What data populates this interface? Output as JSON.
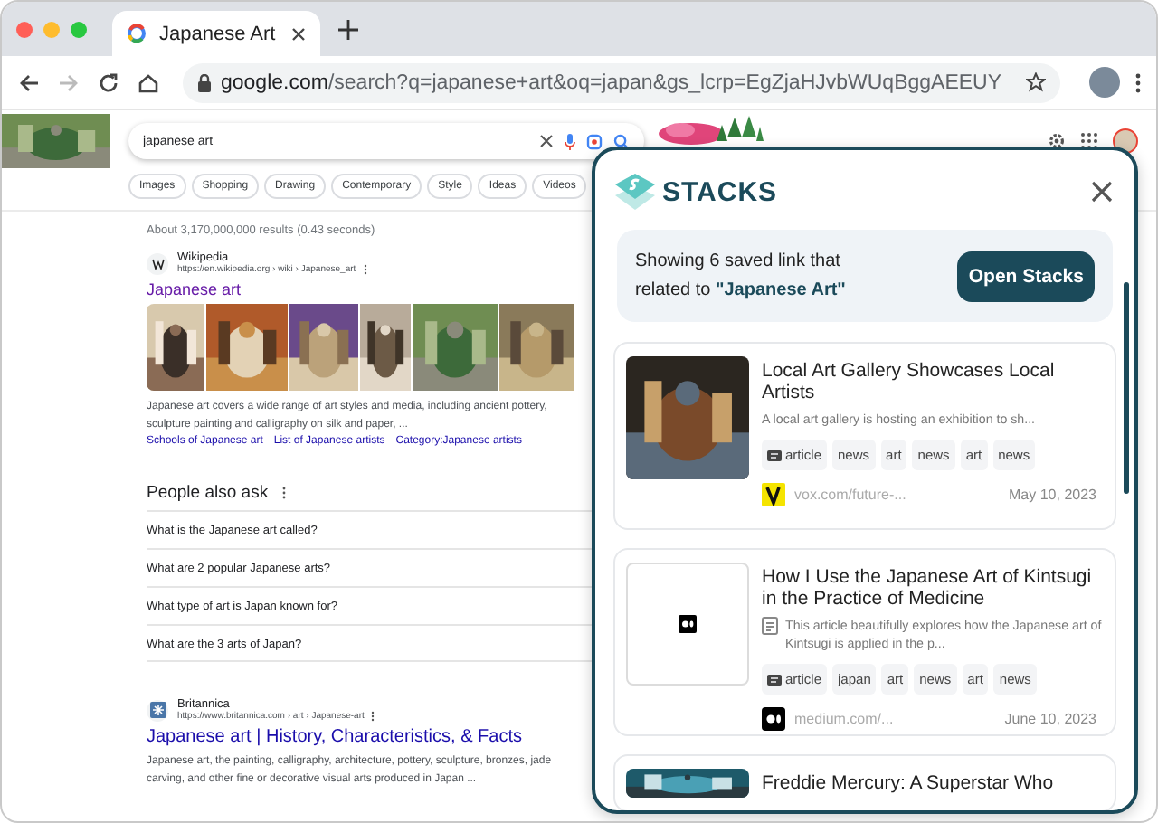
{
  "browser": {
    "tab": {
      "title": "Japanese Art"
    },
    "url": {
      "host": "google.com",
      "path": "/search?q=japanese+art&oq=japan&gs_lcrp=EgZjaHJvbWUqBggAEEUY"
    }
  },
  "search": {
    "query": "japanese art",
    "chips": [
      "Images",
      "Shopping",
      "Drawing",
      "Contemporary",
      "Style",
      "Ideas",
      "Videos"
    ]
  },
  "results": {
    "stats": "About 3,170,000,000 results (0.43 seconds)",
    "items": [
      {
        "kind": "web",
        "source": "Wikipedia",
        "favicon": {
          "kind": "wiki"
        },
        "url": "https://en.wikipedia.org › wiki › Japanese_art",
        "title": "Japanese art",
        "visited": true,
        "images": [
          {
            "kind": "picture"
          },
          {
            "kind": "picture"
          },
          {
            "kind": "picture"
          },
          {
            "kind": "picture"
          },
          {
            "kind": "picture"
          },
          {
            "kind": "picture"
          }
        ],
        "snippet": "Japanese art covers a wide range of art styles and media, including ancient pottery, sculpture painting and calligraphy on silk and paper, ...",
        "links": [
          "Schools of Japanese art",
          "List of Japanese artists",
          "Category:Japanese artists"
        ]
      },
      {
        "kind": "questions",
        "title": "People also ask",
        "questions": [
          "What is the Japanese art called?",
          "What are 2 popular Japanese arts?",
          "What type of art is Japan known for?",
          "What are the 3 arts of Japan?"
        ]
      },
      {
        "kind": "web",
        "source": "Britannica",
        "favicon": {
          "kind": "britannica"
        },
        "url": "https://www.britannica.com › art › Japanese-art",
        "title": "Japanese art | History, Characteristics, & Facts",
        "visited": false,
        "snippet": "Japanese art, the painting, calligraphy, architecture, pottery, sculpture, bronzes, jade carving, and other fine or decorative visual arts produced in Japan ..."
      }
    ]
  },
  "stacks": {
    "brand": "STACKS",
    "summary": "Showing 6 saved link that related to  **\"Japanese Art\"**",
    "open_button": "Open Stacks",
    "cards": [
      {
        "thumbnail": {
          "kind": "picture"
        },
        "title": "Local Art Gallery Showcases Local Artists",
        "description": "A local art gallery is hosting an exhibition to sh...",
        "description_icon": false,
        "tags": [
          {
            "kind": "type",
            "label": "article"
          },
          {
            "kind": "tag",
            "label": "news"
          },
          {
            "kind": "tag",
            "label": "art"
          },
          {
            "kind": "tag",
            "label": "news"
          },
          {
            "kind": "tag",
            "label": "art"
          },
          {
            "kind": "tag",
            "label": "news"
          }
        ],
        "favicon": {
          "kind": "vox"
        },
        "source": "vox.com/future-...",
        "date": "May 10, 2023"
      },
      {
        "thumbnail": {
          "kind": "medium"
        },
        "title": "How I Use the Japanese Art of Kintsugi in the Practice of Medicine",
        "description": "This article beautifully explores how the Japanese art of Kintsugi is applied in the p...",
        "description_icon": true,
        "tags": [
          {
            "kind": "type",
            "label": "article"
          },
          {
            "kind": "tag",
            "label": "japan"
          },
          {
            "kind": "tag",
            "label": "art"
          },
          {
            "kind": "tag",
            "label": "news"
          },
          {
            "kind": "tag",
            "label": "art"
          },
          {
            "kind": "tag",
            "label": "news"
          }
        ],
        "favicon": {
          "kind": "medium"
        },
        "source": "medium.com/...",
        "date": "June 10, 2023"
      },
      {
        "thumbnail": {
          "kind": "picture"
        },
        "title": "Freddie Mercury: A Superstar Who"
      }
    ]
  }
}
